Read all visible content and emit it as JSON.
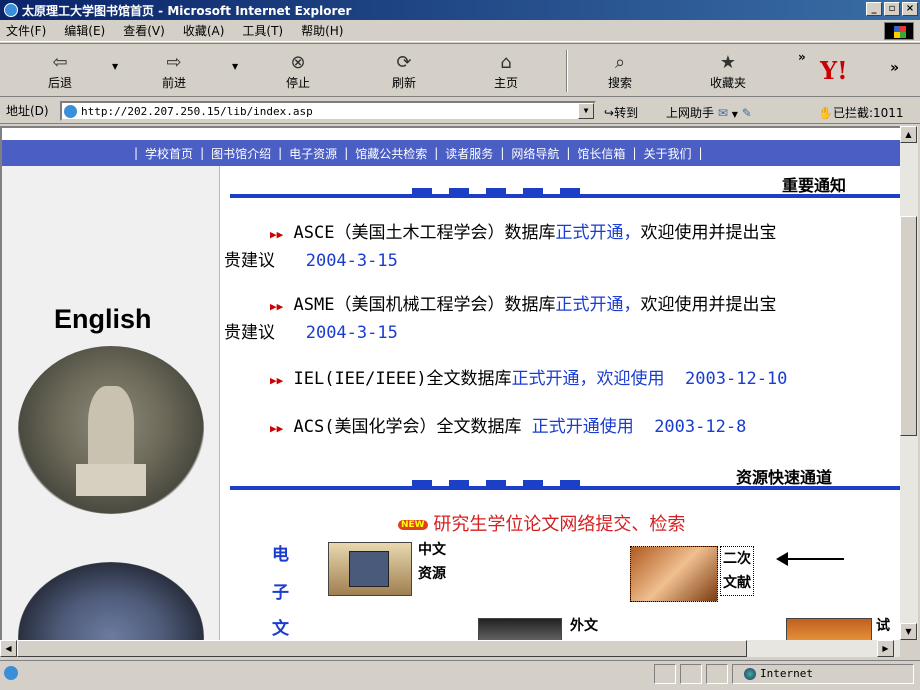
{
  "window": {
    "title": "太原理工大学图书馆首页 - Microsoft Internet Explorer"
  },
  "menubar": [
    "文件(F)",
    "编辑(E)",
    "查看(V)",
    "收藏(A)",
    "工具(T)",
    "帮助(H)"
  ],
  "toolbar": {
    "back": "后退",
    "forward": "前进",
    "stop": "停止",
    "refresh": "刷新",
    "home": "主页",
    "search": "搜索",
    "favorites": "收藏夹"
  },
  "addressbar": {
    "label": "地址(D)",
    "url": "http://202.207.250.15/lib/index.asp",
    "go": "转到",
    "helper": "上网助手",
    "blocked": "已拦截:1011"
  },
  "nav": {
    "items": [
      "学校首页",
      "图书馆介绍",
      "电子资源",
      "馆藏公共检索",
      "读者服务",
      "网络导航",
      "馆长信箱",
      "关于我们"
    ]
  },
  "sidebar": {
    "english": "English"
  },
  "notice": {
    "title": "重要通知",
    "items": [
      {
        "pre": "ASCE（美国土木工程学会）数据库",
        "link": "正式开通，",
        "post": "欢迎使用并提出宝",
        "cont": "贵建议",
        "date": "2004-3-15"
      },
      {
        "pre": "ASME（美国机械工程学会）数据库",
        "link": "正式开通，",
        "post": "欢迎使用并提出宝",
        "cont": "贵建议",
        "date": "2004-3-15"
      },
      {
        "pre": "IEL(IEE/IEEE)全文数据库",
        "link": "正式开通，欢迎使用",
        "post": "",
        "cont": "",
        "date": "2003-12-10"
      },
      {
        "pre": "ACS(美国化学会）全文数据库",
        "link": "正式开通使用",
        "post": "",
        "cont": "",
        "date": "2003-12-8"
      }
    ]
  },
  "quick": {
    "title": "资源快速通道",
    "new_badge": "NEW",
    "thesis": "研究生学位论文网络提交、检索",
    "vertical": [
      "电",
      "子",
      "文"
    ],
    "chinese": [
      "中文",
      "资源"
    ],
    "secondary": [
      "二次",
      "文献"
    ],
    "foreign": "外文",
    "trial": "试用"
  },
  "status": {
    "zone": "Internet"
  }
}
